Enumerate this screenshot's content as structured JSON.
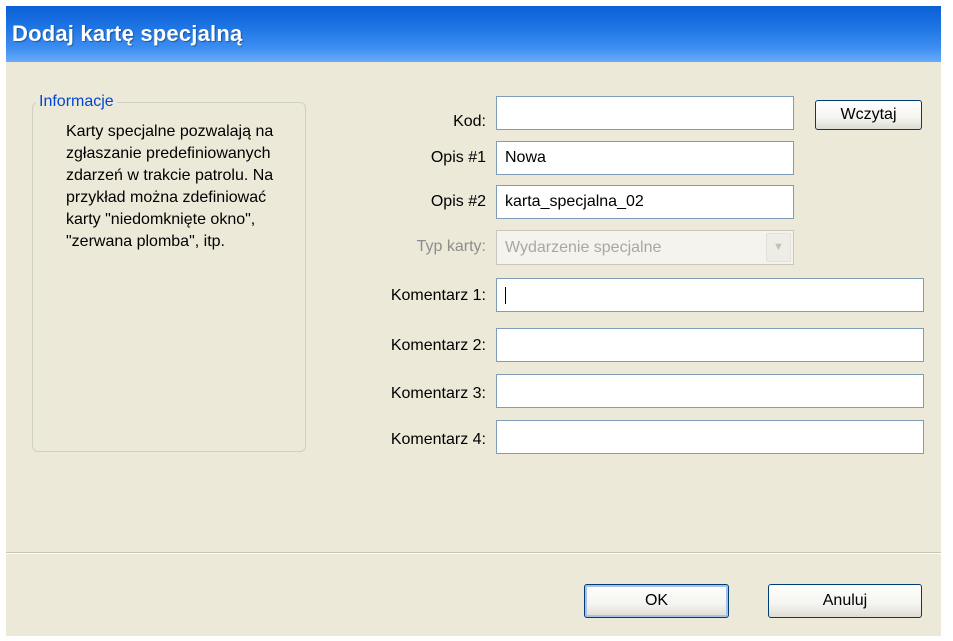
{
  "dialog": {
    "title": "Dodaj kartę specjalną"
  },
  "info": {
    "legend": "Informacje",
    "text": "Karty specjalne pozwalają na zgłaszanie predefiniowanych zdarzeń w trakcie patrolu. Na przykład można zdefiniować karty \"niedomknięte okno\", \"zerwana plomba\", itp."
  },
  "form": {
    "kod": {
      "label": "Kod:",
      "value": ""
    },
    "load_button": "Wczytaj",
    "opis1": {
      "label": "Opis #1",
      "value": "Nowa"
    },
    "opis2": {
      "label": "Opis #2",
      "value": "karta_specjalna_02"
    },
    "typ": {
      "label": "Typ karty:",
      "value": "Wydarzenie specjalne",
      "disabled": true
    },
    "komentarz1": {
      "label": "Komentarz 1:",
      "value": ""
    },
    "komentarz2": {
      "label": "Komentarz 2:",
      "value": ""
    },
    "komentarz3": {
      "label": "Komentarz 3:",
      "value": ""
    },
    "komentarz4": {
      "label": "Komentarz 4:",
      "value": ""
    }
  },
  "buttons": {
    "ok": "OK",
    "cancel": "Anuluj"
  },
  "icons": {
    "combo_arrow": "chevron-down-icon"
  },
  "colors": {
    "title_bar": "#1f76e4",
    "dialog_bg": "#ece9d8",
    "legend": "#0046d5"
  }
}
